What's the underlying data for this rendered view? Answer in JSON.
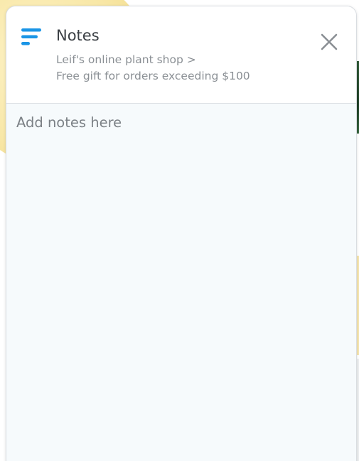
{
  "panel": {
    "title": "Notes",
    "breadcrumb_line1": "Leif's online plant shop >",
    "breadcrumb_line2": "Free gift for orders exceeding $100",
    "notes_placeholder": "Add notes here",
    "notes_value": "",
    "title_icon": "notes-lines-icon",
    "close_icon": "close-icon"
  },
  "colors": {
    "accent": "#1a95e6",
    "close_icon": "#8a8f94",
    "panel_background": "#f6fafc"
  }
}
